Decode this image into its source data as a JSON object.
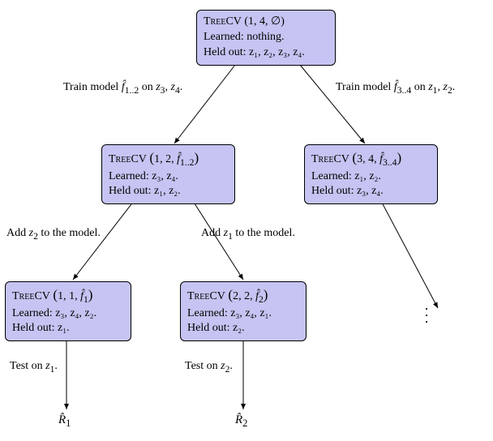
{
  "nodes": {
    "root": {
      "title_html": "T<span style='font-variant:small-caps'>ree</span>CV (1, 4, &empty;)",
      "learned": "Learned: nothing.",
      "held": "Held out: z₁, z₂, z₃, z₄."
    },
    "left": {
      "title_html": "T<span style='font-variant:small-caps'>ree</span>CV (1, 2, f&#770;<sub>1..2</sub>)",
      "learned": "Learned: z₃, z₄.",
      "held": "Held out: z₁, z₂."
    },
    "right": {
      "title_html": "T<span style='font-variant:small-caps'>ree</span>CV (3, 4, f&#770;<sub>3..4</sub>)",
      "learned": "Learned: z₁, z₂.",
      "held": "Held out: z₃, z₄."
    },
    "ll": {
      "title_html": "T<span style='font-variant:small-caps'>ree</span>CV (1, 1, f&#770;<sub>1</sub>)",
      "learned": "Learned: z₃, z₄, z₂.",
      "held": "Held out: z₁."
    },
    "lr": {
      "title_html": "T<span style='font-variant:small-caps'>ree</span>CV (2, 2, f&#770;<sub>2</sub>)",
      "learned": "Learned: z₃, z₄, z₁.",
      "held": "Held out: z₂."
    }
  },
  "edges": {
    "root_left": "Train model f̂1..2 on z₃, z₄.",
    "root_left_html": "Train model <i>f&#770;</i><sub>1..2</sub> on <i>z</i><sub>3</sub>, <i>z</i><sub>4</sub>.",
    "root_right_html": "Train model <i>f&#770;</i><sub>3..4</sub> on <i>z</i><sub>1</sub>, <i>z</i><sub>2</sub>.",
    "left_ll_html": "Add <i>z</i><sub>2</sub> to the model.",
    "left_lr_html": "Add <i>z</i><sub>1</sub> to the model.",
    "ll_r1_html": "Test on <i>z</i><sub>1</sub>.",
    "lr_r2_html": "Test on <i>z</i><sub>2</sub>."
  },
  "results": {
    "r1": "R̂1",
    "r1_html": "<i>R&#770;</i><sub>1</sub>",
    "r2_html": "<i>R&#770;</i><sub>2</sub>"
  }
}
